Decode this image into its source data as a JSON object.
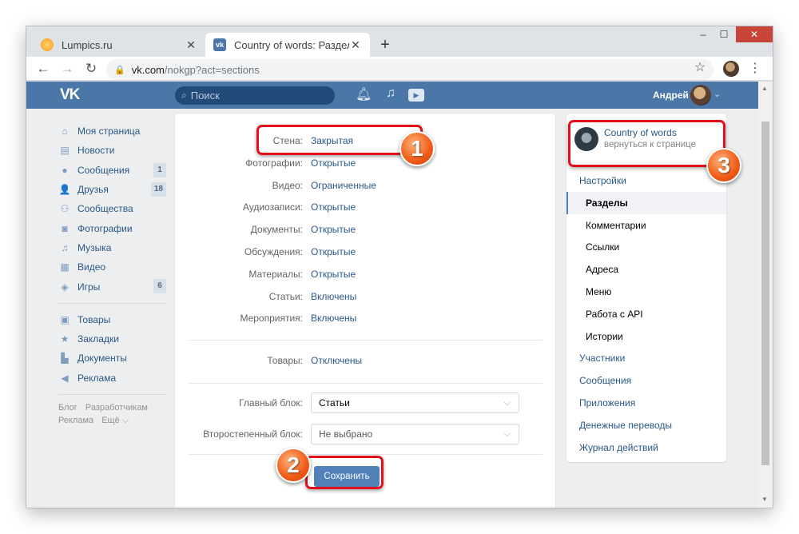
{
  "browser": {
    "tabs": [
      {
        "title": "Lumpics.ru",
        "close": "✕"
      },
      {
        "title": "Country of words: Разделы",
        "close": "✕"
      }
    ],
    "new_tab": "+",
    "url_host": "vk.com",
    "url_path": "/nokgp?act=sections",
    "window_controls": {
      "minimize": "‒",
      "maximize": "☐",
      "close": "✕"
    },
    "nav": {
      "back": "←",
      "forward": "→",
      "reload": "↻"
    }
  },
  "vk": {
    "logo": "VK",
    "search_placeholder": "Поиск",
    "user_name": "Андрей"
  },
  "left_menu": {
    "items": [
      {
        "label": "Моя страница",
        "icon": "home-icon",
        "glyph": "⌂"
      },
      {
        "label": "Новости",
        "icon": "news-icon",
        "glyph": "▤"
      },
      {
        "label": "Сообщения",
        "icon": "message-icon",
        "glyph": "●",
        "count": "1"
      },
      {
        "label": "Друзья",
        "icon": "friends-icon",
        "glyph": "👤",
        "count": "18"
      },
      {
        "label": "Сообщества",
        "icon": "communities-icon",
        "glyph": "⚇"
      },
      {
        "label": "Фотографии",
        "icon": "camera-icon",
        "glyph": "◙"
      },
      {
        "label": "Музыка",
        "icon": "music-icon",
        "glyph": "♫"
      },
      {
        "label": "Видео",
        "icon": "video-icon",
        "glyph": "▦"
      },
      {
        "label": "Игры",
        "icon": "gamepad-icon",
        "glyph": "◈",
        "count": "6"
      }
    ],
    "items2": [
      {
        "label": "Товары",
        "icon": "bag-icon",
        "glyph": "▣"
      },
      {
        "label": "Закладки",
        "icon": "star-icon",
        "glyph": "★"
      },
      {
        "label": "Документы",
        "icon": "document-icon",
        "glyph": "▙"
      },
      {
        "label": "Реклама",
        "icon": "megaphone-icon",
        "glyph": "◀"
      }
    ],
    "footer": [
      "Блог",
      "Разработчикам",
      "Реклама",
      "Ещё ⌵"
    ]
  },
  "sections": [
    {
      "label": "Стена:",
      "value": "Закрытая"
    },
    {
      "label": "Фотографии:",
      "value": "Открытые"
    },
    {
      "label": "Видео:",
      "value": "Ограниченные"
    },
    {
      "label": "Аудиозаписи:",
      "value": "Открытые"
    },
    {
      "label": "Документы:",
      "value": "Открытые"
    },
    {
      "label": "Обсуждения:",
      "value": "Открытые"
    },
    {
      "label": "Материалы:",
      "value": "Открытые"
    },
    {
      "label": "Статьи:",
      "value": "Включены"
    },
    {
      "label": "Мероприятия:",
      "value": "Включены"
    }
  ],
  "goods": {
    "label": "Товары:",
    "value": "Отключены"
  },
  "main_block": {
    "label": "Главный блок:",
    "value": "Статьи"
  },
  "secondary_block": {
    "label": "Второстепенный блок:",
    "value": "Не выбрано"
  },
  "save_label": "Сохранить",
  "right_menu": {
    "group_name": "Country of words",
    "group_back": "вернуться к странице",
    "items": [
      {
        "label": "Настройки",
        "kind": "top"
      },
      {
        "label": "Разделы",
        "kind": "active"
      },
      {
        "label": "Комментарии",
        "kind": "sub"
      },
      {
        "label": "Ссылки",
        "kind": "sub"
      },
      {
        "label": "Адреса",
        "kind": "sub"
      },
      {
        "label": "Меню",
        "kind": "sub"
      },
      {
        "label": "Работа с API",
        "kind": "sub"
      },
      {
        "label": "Истории",
        "kind": "sub"
      },
      {
        "label": "Участники",
        "kind": "top"
      },
      {
        "label": "Сообщения",
        "kind": "top"
      },
      {
        "label": "Приложения",
        "kind": "top"
      },
      {
        "label": "Денежные переводы",
        "kind": "top"
      },
      {
        "label": "Журнал действий",
        "kind": "top"
      }
    ]
  },
  "annotations": [
    "1",
    "2",
    "3"
  ],
  "colors": {
    "vk_blue": "#4a76a8",
    "link": "#2a5885",
    "highlight_red": "#e3101c",
    "badge_orange": "#f15a16"
  }
}
